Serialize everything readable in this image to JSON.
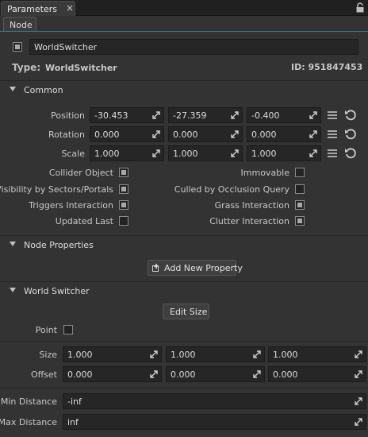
{
  "window": {
    "tab_label": "Parameters",
    "close_glyph": "×",
    "lock_icon": "lock-icon"
  },
  "subtab": {
    "label": "Node"
  },
  "node": {
    "name": "WorldSwitcher",
    "type_label": "Type:",
    "type_value": "WorldSwitcher",
    "id_label": "ID: 951847453"
  },
  "common": {
    "title": "Common",
    "position": {
      "label": "Position",
      "values": [
        "-30.453",
        "-27.359",
        "-0.400"
      ]
    },
    "rotation": {
      "label": "Rotation",
      "values": [
        "0.000",
        "0.000",
        "0.000"
      ]
    },
    "scale": {
      "label": "Scale",
      "values": [
        "1.000",
        "1.000",
        "1.000"
      ]
    },
    "flags": {
      "collider_object": {
        "label": "Collider Object",
        "checked": true
      },
      "immovable": {
        "label": "Immovable",
        "checked": false
      },
      "visibility_sectors": {
        "label": "Visibility by Sectors/Portals",
        "checked": true
      },
      "culled_occlusion": {
        "label": "Culled by Occlusion Query",
        "checked": false
      },
      "triggers_interaction": {
        "label": "Triggers Interaction",
        "checked": true
      },
      "grass_interaction": {
        "label": "Grass Interaction",
        "checked": true
      },
      "updated_last": {
        "label": "Updated Last",
        "checked": false
      },
      "clutter_interaction": {
        "label": "Clutter Interaction",
        "checked": true
      }
    }
  },
  "node_properties": {
    "title": "Node Properties",
    "add_button": "Add New Property"
  },
  "world_switcher": {
    "title": "World Switcher",
    "edit_size_button": "Edit Size",
    "point": {
      "label": "Point",
      "checked": false
    },
    "size": {
      "label": "Size",
      "values": [
        "1.000",
        "1.000",
        "1.000"
      ]
    },
    "offset": {
      "label": "Offset",
      "values": [
        "0.000",
        "0.000",
        "0.000"
      ]
    },
    "min_distance": {
      "label": "Min Distance",
      "value": "-inf"
    },
    "max_distance": {
      "label": "Max Distance",
      "value": "inf"
    }
  },
  "colors": {
    "accent_line": "#4a6f84",
    "panel_bg": "#333333",
    "field_bg": "#262626"
  }
}
